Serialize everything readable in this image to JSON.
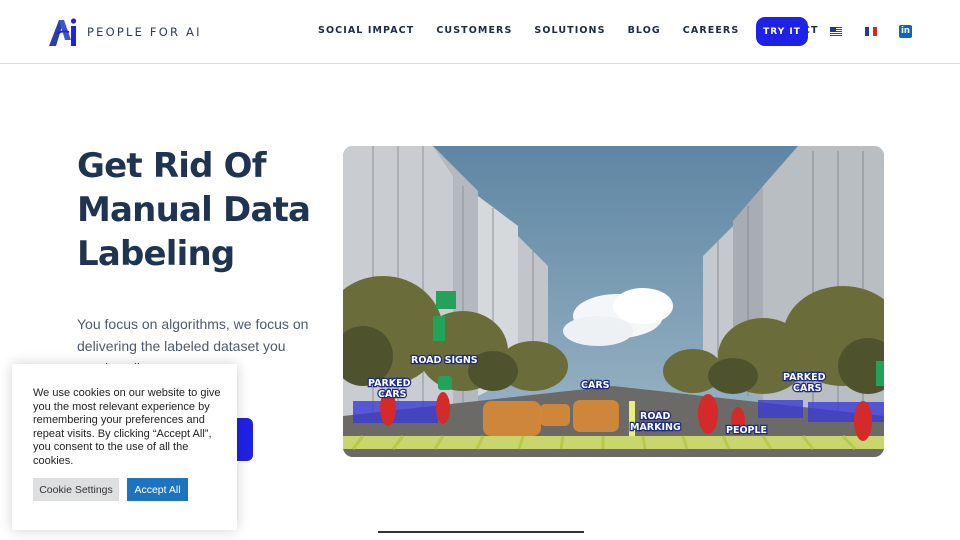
{
  "header": {
    "logo_text": "PEOPLE FOR AI",
    "nav": [
      "SOCIAL IMPACT",
      "CUSTOMERS",
      "SOLUTIONS",
      "BLOG",
      "CAREERS",
      "CONTACT"
    ],
    "cta_label": "TRY IT",
    "language_flags": [
      "us-flag-icon",
      "fr-flag-icon"
    ],
    "social_icon": "linkedin-icon",
    "linkedin_glyph": "in"
  },
  "hero": {
    "title": "Get Rid Of Manual Data Labeling",
    "subtitle": "You focus on algorithms, we focus on delivering the labeled dataset you need …eling.",
    "accent_color": "#1d22e6",
    "image_labels": {
      "road_signs": "ROAD SIGNS",
      "parked_cars_left": [
        "PARKED",
        "CARS"
      ],
      "cars": "CARS",
      "road_marking": [
        "ROAD",
        "MARKING"
      ],
      "people": "PEOPLE",
      "parked_cars_right": [
        "PARKED",
        "CARS"
      ]
    }
  },
  "cookie_banner": {
    "text": "We use cookies on our website to give you the most relevant experience by remembering your preferences and repeat visits. By clicking “Accept All”, you consent to the use of all the cookies.",
    "settings_label": "Cookie Settings",
    "accept_label": "Accept All"
  }
}
